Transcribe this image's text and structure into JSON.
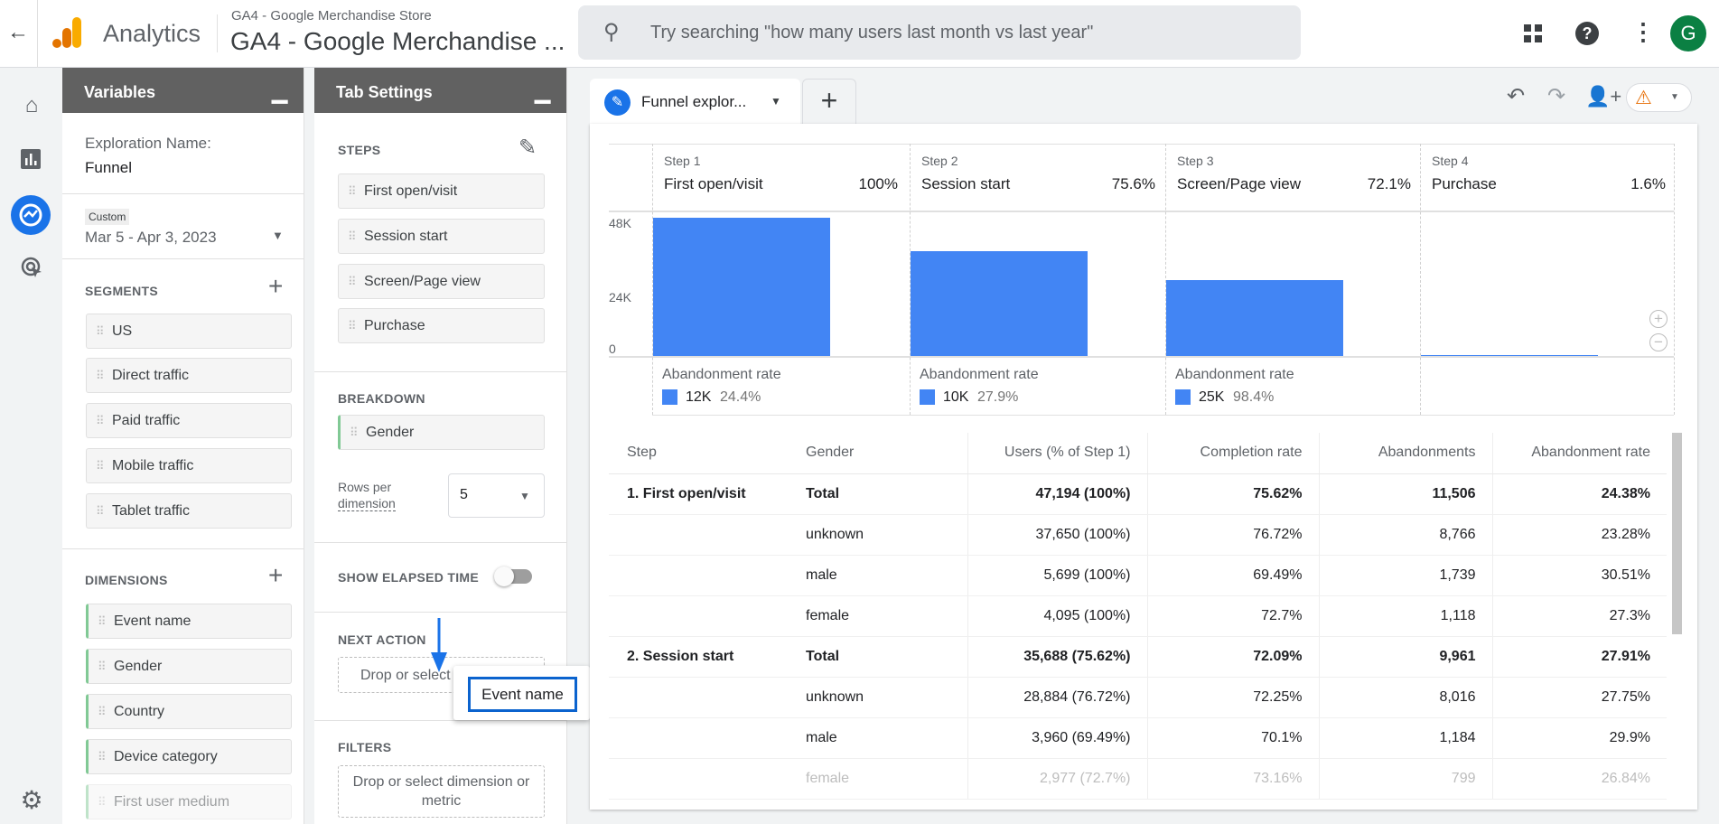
{
  "topbar": {
    "app_name": "Analytics",
    "property_small": "GA4 - Google Merchandise Store",
    "property_title": "GA4 - Google Merchandise ...",
    "search_placeholder": "Try searching \"how many users last month vs last year\"",
    "avatar_letter": "G"
  },
  "rail": {
    "icons": [
      "home-icon",
      "reports-icon",
      "explore-icon",
      "advertising-icon",
      "settings-icon"
    ]
  },
  "variables": {
    "title": "Variables",
    "exploration_label": "Exploration Name:",
    "exploration_name": "Funnel",
    "date_chip": "Custom",
    "date_range": "Mar 5 - Apr 3, 2023",
    "segments_title": "SEGMENTS",
    "segments": [
      "US",
      "Direct traffic",
      "Paid traffic",
      "Mobile traffic",
      "Tablet traffic"
    ],
    "dimensions_title": "DIMENSIONS",
    "dimensions": [
      "Event name",
      "Gender",
      "Country",
      "Device category",
      "First user medium"
    ]
  },
  "tab_settings": {
    "title": "Tab Settings",
    "steps_title": "STEPS",
    "steps": [
      "First open/visit",
      "Session start",
      "Screen/Page view",
      "Purchase"
    ],
    "breakdown_title": "BREAKDOWN",
    "breakdown": "Gender",
    "rows_label_1": "Rows per",
    "rows_label_2": "dimension",
    "rows_value": "5",
    "elapsed_title": "SHOW ELAPSED TIME",
    "elapsed_on": false,
    "next_action_title": "NEXT ACTION",
    "next_action_placeholder": "Drop or select",
    "filters_title": "FILTERS",
    "filters_placeholder": "Drop or select dimension or metric"
  },
  "drag_tooltip": "Event name",
  "tabs": {
    "active": "Funnel explor...",
    "add": "+"
  },
  "colors": {
    "bar": "#4285f4",
    "accent": "#1a73e8",
    "header": "#616161",
    "warning": "#e8710a"
  },
  "chart_data": {
    "type": "bar",
    "steps": [
      {
        "step": "Step 1",
        "name": "First open/visit",
        "pct": "100%",
        "users": 47194,
        "ab_count": "12K",
        "ab_rate": "24.4%"
      },
      {
        "step": "Step 2",
        "name": "Session start",
        "pct": "75.6%",
        "users": 35688,
        "ab_count": "10K",
        "ab_rate": "27.9%"
      },
      {
        "step": "Step 3",
        "name": "Screen/Page view",
        "pct": "72.1%",
        "users": 25727,
        "ab_count": "25K",
        "ab_rate": "98.4%"
      },
      {
        "step": "Step 4",
        "name": "Purchase",
        "pct": "1.6%",
        "users": 412,
        "ab_count": "",
        "ab_rate": ""
      }
    ],
    "abandonment_label": "Abandonment rate",
    "yticks": [
      "48K",
      "24K",
      "0"
    ],
    "ylim": [
      0,
      48000
    ]
  },
  "table": {
    "headers": [
      "Step",
      "Gender",
      "Users (% of Step 1)",
      "Completion rate",
      "Abandonments",
      "Abandonment rate"
    ],
    "rows": [
      {
        "step": "1. First open/visit",
        "gender": "Total",
        "users": "47,194 (100%)",
        "completion": "75.62%",
        "abandon": "11,506",
        "abrate": "24.38%",
        "total": true
      },
      {
        "step": "",
        "gender": "unknown",
        "users": "37,650 (100%)",
        "completion": "76.72%",
        "abandon": "8,766",
        "abrate": "23.28%"
      },
      {
        "step": "",
        "gender": "male",
        "users": "5,699 (100%)",
        "completion": "69.49%",
        "abandon": "1,739",
        "abrate": "30.51%"
      },
      {
        "step": "",
        "gender": "female",
        "users": "4,095 (100%)",
        "completion": "72.7%",
        "abandon": "1,118",
        "abrate": "27.3%"
      },
      {
        "step": "2. Session start",
        "gender": "Total",
        "users": "35,688 (75.62%)",
        "completion": "72.09%",
        "abandon": "9,961",
        "abrate": "27.91%",
        "total": true
      },
      {
        "step": "",
        "gender": "unknown",
        "users": "28,884 (76.72%)",
        "completion": "72.25%",
        "abandon": "8,016",
        "abrate": "27.75%"
      },
      {
        "step": "",
        "gender": "male",
        "users": "3,960 (69.49%)",
        "completion": "70.1%",
        "abandon": "1,184",
        "abrate": "29.9%"
      },
      {
        "step": "",
        "gender": "female",
        "users": "2,977 (72.7%)",
        "completion": "73.16%",
        "abandon": "799",
        "abrate": "26.84%",
        "fade": true
      }
    ]
  }
}
